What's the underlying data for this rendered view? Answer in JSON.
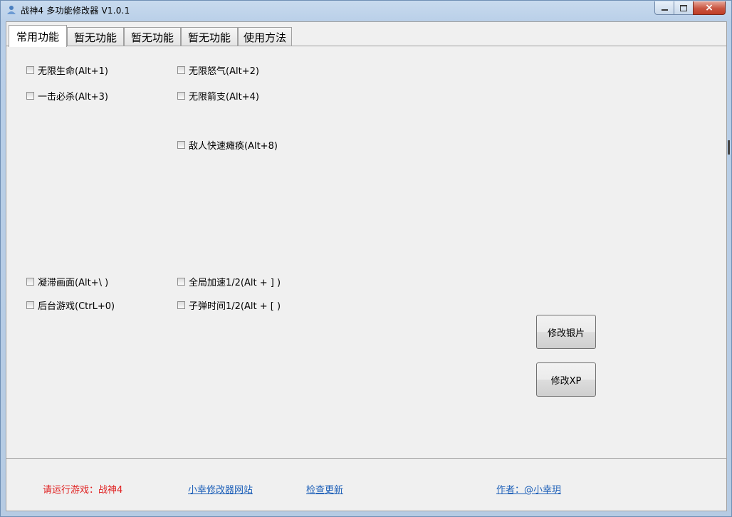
{
  "window": {
    "title": "战神4 多功能修改器  V1.0.1",
    "controls": {
      "minimize": "minimize",
      "maximize": "maximize",
      "close": "×"
    }
  },
  "tabs": [
    "常用功能",
    "暂无功能",
    "暂无功能",
    "暂无功能",
    "使用方法"
  ],
  "active_tab": 0,
  "checkboxes": {
    "infinite_health": {
      "label": "无限生命(Alt+1)",
      "checked": false
    },
    "infinite_rage": {
      "label": "无限怒气(Alt+2)",
      "checked": false
    },
    "one_hit_kill": {
      "label": "一击必杀(Alt+3)",
      "checked": false
    },
    "infinite_arrows": {
      "label": "无限箭支(Alt+4)",
      "checked": false
    },
    "enemy_quick_stun": {
      "label": "敌人快速瘫痪(Alt+8)",
      "checked": false
    },
    "freeze_frame": {
      "label": "凝滞画面(Alt+\\ )",
      "checked": false
    },
    "global_speed": {
      "label": "全局加速1/2(Alt + ] )",
      "checked": false
    },
    "background_play": {
      "label": "后台游戏(CtrL+0)",
      "checked": false
    },
    "bullet_time": {
      "label": "子弹时间1/2(Alt + [ )",
      "checked": false
    }
  },
  "buttons": {
    "modify_silver": "修改银片",
    "modify_xp": "修改XP"
  },
  "footer": {
    "status": "请运行游戏：战神4",
    "site_link": "小幸修改器网站",
    "update_link": "检查更新",
    "author_link": "作者：@小幸玥"
  },
  "colors": {
    "status_red": "#e02020",
    "link_blue": "#1c5fb8",
    "panel_bg": "#f0f0f0"
  }
}
